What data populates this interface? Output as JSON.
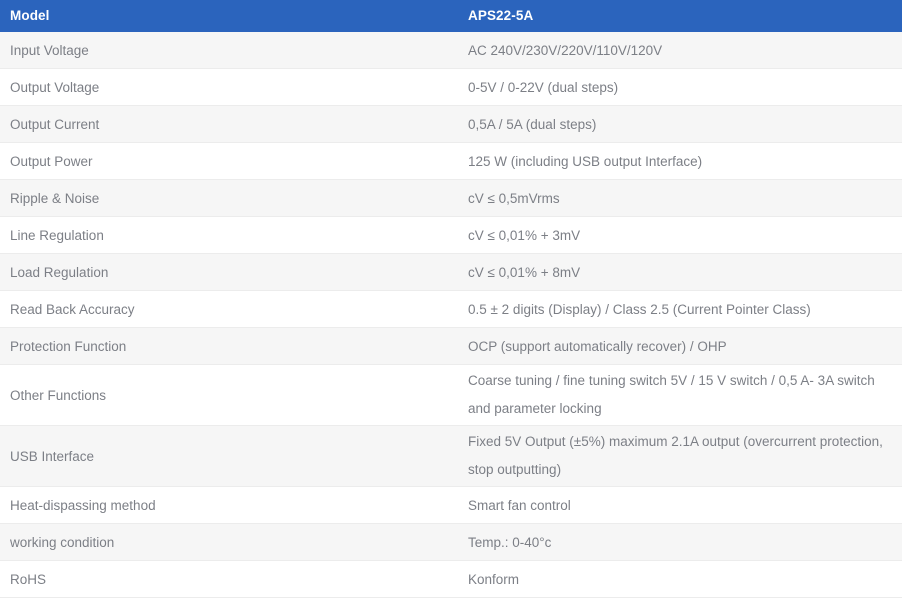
{
  "table": {
    "header": {
      "label": "Model",
      "value": "APS22-5A",
      "background_color": "#2b64bd",
      "text_color": "#ffffff"
    },
    "colors": {
      "row_odd_background": "#f6f6f6",
      "row_even_background": "#ffffff",
      "body_text": "#7c7f86",
      "row_divider": "#ececec"
    },
    "rows": [
      {
        "label": "Input Voltage",
        "value": "AC 240V/230V/220V/110V/120V",
        "lines": 1
      },
      {
        "label": "Output Voltage",
        "value": "0-5V / 0-22V (dual steps)",
        "lines": 1
      },
      {
        "label": "Output Current",
        "value": "0,5A / 5A (dual steps)",
        "lines": 1
      },
      {
        "label": "Output Power",
        "value": "125 W (including USB output Interface)",
        "lines": 1
      },
      {
        "label": "Ripple & Noise",
        "value": "cV ≤ 0,5mVrms",
        "lines": 1
      },
      {
        "label": "Line Regulation",
        "value": "cV ≤ 0,01% + 3mV",
        "lines": 1
      },
      {
        "label": "Load Regulation",
        "value": "cV ≤ 0,01% + 8mV",
        "lines": 1
      },
      {
        "label": "Read Back Accuracy",
        "value": "0.5 ± 2 digits (Display) / Class 2.5 (Current Pointer Class)",
        "lines": 1
      },
      {
        "label": "Protection Function",
        "value": "OCP (support automatically recover) / OHP",
        "lines": 1
      },
      {
        "label": "Other Functions",
        "value": "Coarse tuning / fine tuning switch 5V / 15 V switch / 0,5 A- 3A switch and parameter locking",
        "lines": 2
      },
      {
        "label": "USB Interface",
        "value": "Fixed 5V Output (±5%) maximum 2.1A output (overcurrent protection, stop outputting)",
        "lines": 2
      },
      {
        "label": "Heat-dispassing method",
        "value": "Smart fan control",
        "lines": 1
      },
      {
        "label": "working condition",
        "value": "Temp.: 0-40°c",
        "lines": 1
      },
      {
        "label": "RoHS",
        "value": "Konform",
        "lines": 1
      }
    ]
  }
}
